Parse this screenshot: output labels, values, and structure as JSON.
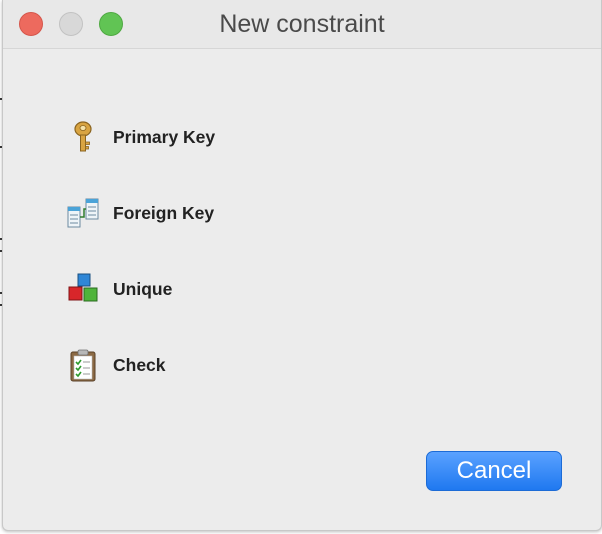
{
  "window": {
    "title": "New constraint",
    "controls": [
      "close",
      "minimize",
      "zoom"
    ]
  },
  "options": [
    {
      "label": "Primary Key",
      "icon": "key-icon"
    },
    {
      "label": "Foreign Key",
      "icon": "foreign-key-icon"
    },
    {
      "label": "Unique",
      "icon": "unique-blocks-icon"
    },
    {
      "label": "Check",
      "icon": "clipboard-check-icon"
    }
  ],
  "buttons": {
    "cancel_label": "Cancel"
  },
  "colors": {
    "window_bg": "#ececec",
    "close": "#ed6a5e",
    "minimize": "#d8d8d8",
    "zoom": "#61c454",
    "accent": "#2b7ff5"
  }
}
